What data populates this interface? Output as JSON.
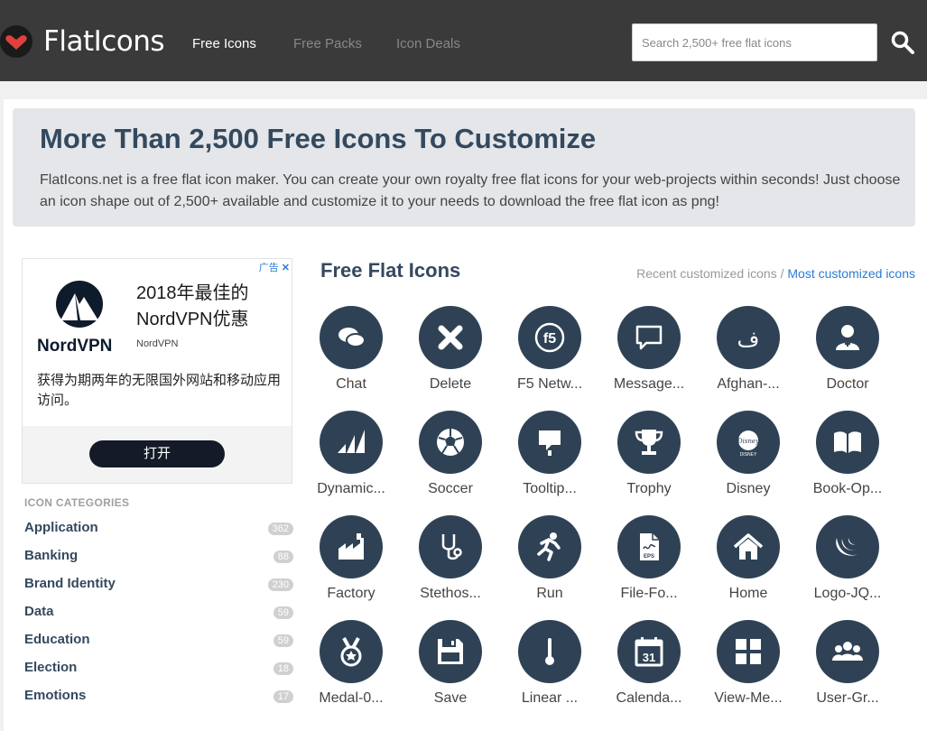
{
  "header": {
    "logo_text": "FlatIcons",
    "nav": [
      {
        "label": "Free Icons",
        "active": true
      },
      {
        "label": "Free Packs",
        "active": false
      },
      {
        "label": "Icon Deals",
        "active": false
      }
    ],
    "search_placeholder": "Search 2,500+ free flat icons"
  },
  "hero": {
    "title": "More Than 2,500 Free Icons To Customize",
    "description": "FlatIcons.net is a free flat icon maker. You can create your own royalty free flat icons for your web-projects within seconds! Just choose an icon shape out of 2,500+ available and customize it to your needs to download the free flat icon as png!"
  },
  "ad": {
    "label": "广告",
    "brand": "NordVPN",
    "headline": "2018年最佳的NordVPN优惠",
    "sub": "NordVPN",
    "body": "获得为期两年的无限国外网站和移动应用访问。",
    "button": "打开"
  },
  "categories": {
    "heading": "ICON CATEGORIES",
    "items": [
      {
        "name": "Application",
        "count": "362"
      },
      {
        "name": "Banking",
        "count": "88"
      },
      {
        "name": "Brand Identity",
        "count": "230"
      },
      {
        "name": "Data",
        "count": "59"
      },
      {
        "name": "Education",
        "count": "59"
      },
      {
        "name": "Election",
        "count": "18"
      },
      {
        "name": "Emotions",
        "count": "17"
      }
    ]
  },
  "icons_section": {
    "title": "Free Flat Icons",
    "sort_recent": "Recent customized icons",
    "sort_separator": "/",
    "sort_most": "Most customized icons",
    "icons": [
      {
        "label": "Chat",
        "icon": "chat-icon"
      },
      {
        "label": "Delete",
        "icon": "delete-icon"
      },
      {
        "label": "F5 Netw...",
        "icon": "f5-icon"
      },
      {
        "label": "Message...",
        "icon": "message-icon"
      },
      {
        "label": "Afghan-...",
        "icon": "afghani-icon"
      },
      {
        "label": "Doctor",
        "icon": "doctor-icon"
      },
      {
        "label": "Dynamic...",
        "icon": "dynamics-icon"
      },
      {
        "label": "Soccer",
        "icon": "soccer-icon"
      },
      {
        "label": "Tooltip...",
        "icon": "tooltip-icon"
      },
      {
        "label": "Trophy",
        "icon": "trophy-icon"
      },
      {
        "label": "Disney",
        "icon": "disney-icon"
      },
      {
        "label": "Book-Op...",
        "icon": "book-icon"
      },
      {
        "label": "Factory",
        "icon": "factory-icon"
      },
      {
        "label": "Stethos...",
        "icon": "stethoscope-icon"
      },
      {
        "label": "Run",
        "icon": "run-icon"
      },
      {
        "label": "File-Fo...",
        "icon": "file-icon"
      },
      {
        "label": "Home",
        "icon": "home-icon"
      },
      {
        "label": "Logo-JQ...",
        "icon": "jquery-icon"
      },
      {
        "label": "Medal-0...",
        "icon": "medal-icon"
      },
      {
        "label": "Save",
        "icon": "save-icon"
      },
      {
        "label": "Linear ...",
        "icon": "thermometer-icon"
      },
      {
        "label": "Calenda...",
        "icon": "calendar-icon"
      },
      {
        "label": "View-Me...",
        "icon": "grid-icon"
      },
      {
        "label": "User-Gr...",
        "icon": "users-icon"
      }
    ]
  }
}
